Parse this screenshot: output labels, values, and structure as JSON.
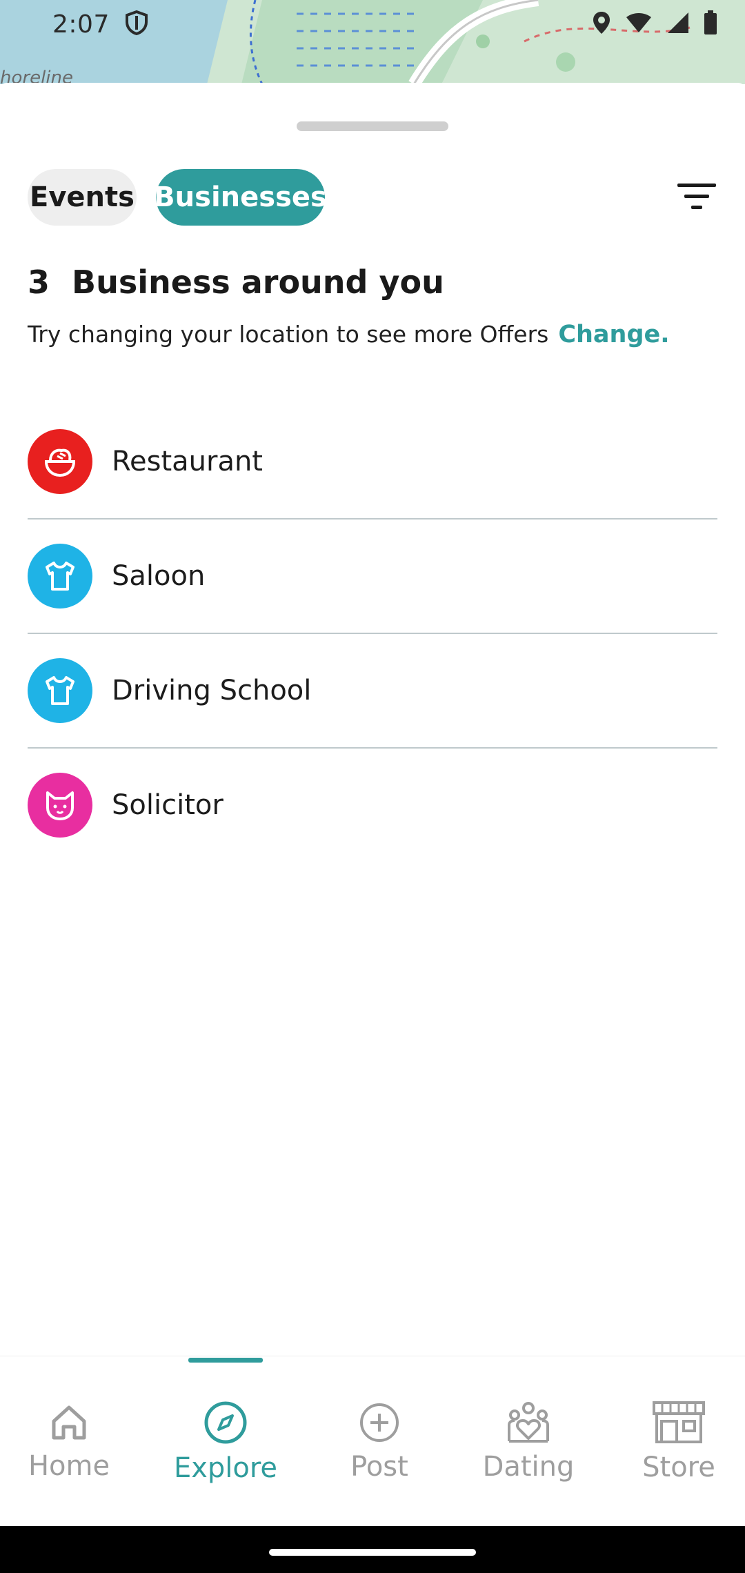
{
  "status_bar": {
    "time": "2:07",
    "icons": [
      "shield-icon",
      "location-icon",
      "wifi-icon",
      "signal-icon",
      "battery-icon"
    ]
  },
  "map": {
    "label": "horeline"
  },
  "tabs": [
    {
      "label": "Events",
      "selected": false
    },
    {
      "label": "Businesses",
      "selected": true
    }
  ],
  "filter": {
    "icon": "filter-icon"
  },
  "heading": {
    "count": "3",
    "text": "Business around you"
  },
  "subline": {
    "text": "Try changing your location to see more Offers",
    "link": "Change."
  },
  "categories": [
    {
      "label": "Restaurant",
      "icon": "food-bowl-icon",
      "color": "#e8201f"
    },
    {
      "label": "Saloon",
      "icon": "tshirt-icon",
      "color": "#1fb3e6"
    },
    {
      "label": "Driving School",
      "icon": "tshirt-icon",
      "color": "#1fb3e6"
    },
    {
      "label": "Solicitor",
      "icon": "cat-face-icon",
      "color": "#e82ea0"
    }
  ],
  "bottom_nav": {
    "items": [
      {
        "label": "Home",
        "icon": "home-icon",
        "active": false
      },
      {
        "label": "Explore",
        "icon": "compass-icon",
        "active": true
      },
      {
        "label": "Post",
        "icon": "add-circle-icon",
        "active": false
      },
      {
        "label": "Dating",
        "icon": "dating-icon",
        "active": false
      },
      {
        "label": "Store",
        "icon": "store-icon",
        "active": false
      }
    ]
  },
  "colors": {
    "accent": "#2f9c9c",
    "restaurant": "#e8201f",
    "blue": "#1fb3e6",
    "pink": "#e82ea0"
  }
}
